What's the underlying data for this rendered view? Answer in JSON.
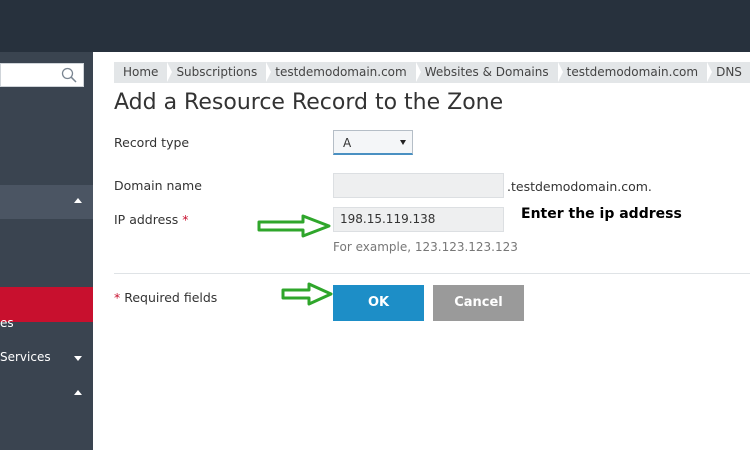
{
  "colors": {
    "topbar": "#27313d",
    "sidebar": "#3a4450",
    "active_item": "#c8102e",
    "ok_button": "#1d8ec7",
    "cancel_button": "#9a9a9a",
    "arrow": "#2fa62b"
  },
  "sidebar": {
    "search_icon": "search-icon",
    "items": [
      {
        "label": "es"
      },
      {
        "label": "Services"
      }
    ]
  },
  "breadcrumb": [
    "Home",
    "Subscriptions",
    "testdemodomain.com",
    "Websites & Domains",
    "testdemodomain.com",
    "DNS"
  ],
  "page": {
    "title": "Add a Resource Record to the Zone"
  },
  "form": {
    "record_type": {
      "label": "Record type",
      "value": "A"
    },
    "domain_name": {
      "label": "Domain name",
      "value": "",
      "suffix": ".testdemodomain.com."
    },
    "ip_address": {
      "label": "IP address",
      "required_mark": "*",
      "value": "198.15.119.138",
      "hint": "For example, 123.123.123.123"
    },
    "required_note": {
      "mark": "*",
      "text": " Required fields"
    }
  },
  "buttons": {
    "ok": "OK",
    "cancel": "Cancel"
  },
  "annotation": {
    "text": "Enter the ip address"
  }
}
